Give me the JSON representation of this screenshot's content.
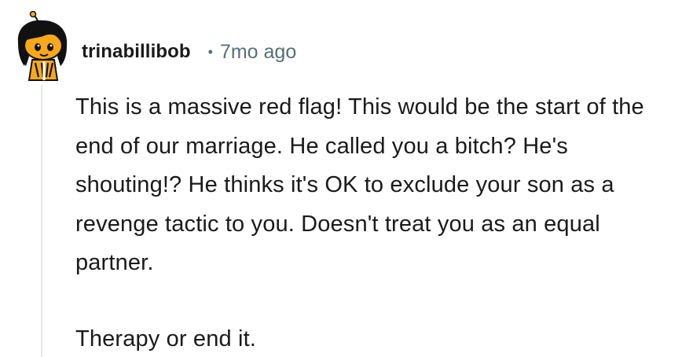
{
  "comment": {
    "author": {
      "username": "trinabillibob",
      "avatar_icon": "snoo-avatar-icon"
    },
    "separator": "•",
    "timestamp": "7mo ago",
    "paragraphs": [
      "This is a massive red flag! This would be the start of the end of our marriage. He called you a bitch? He's shouting!? He thinks it's OK to exclude your son as a revenge tactic to you. Doesn't treat you as an equal partner.",
      "Therapy or end it."
    ]
  },
  "colors": {
    "text_primary": "#1a1a1b",
    "text_meta": "#576f76",
    "thread_line": "#e5ebee",
    "avatar_orange": "#f7a81b",
    "avatar_hair": "#111111"
  }
}
